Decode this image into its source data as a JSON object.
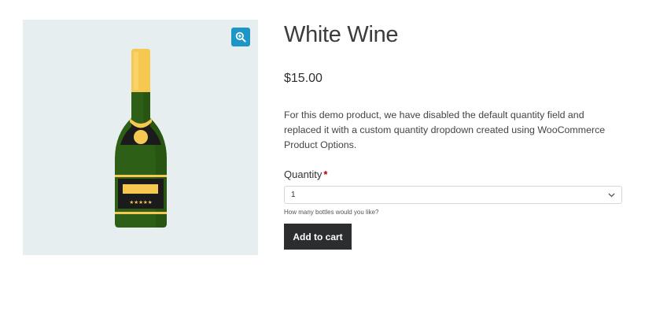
{
  "product": {
    "title": "White Wine",
    "price": "$15.00",
    "description": "For this demo product, we have disabled the default quantity field and replaced it with a custom quantity dropdown created using WooCommerce Product Options.",
    "image_alt": "champagne-bottle",
    "label_stars": "★★★★★"
  },
  "quantity": {
    "label": "Quantity",
    "required_mark": "*",
    "selected_value": "1",
    "help_text": "How many bottles would you like?"
  },
  "actions": {
    "add_to_cart_label": "Add to cart",
    "zoom_icon": "zoom-in-icon"
  },
  "colors": {
    "gallery_bg": "#e6eef0",
    "zoom_accent": "#1c96c6",
    "button_bg": "#2b2d2f",
    "bottle_green": "#2e5f16",
    "bottle_gold": "#f6c751",
    "required": "#b00000"
  }
}
